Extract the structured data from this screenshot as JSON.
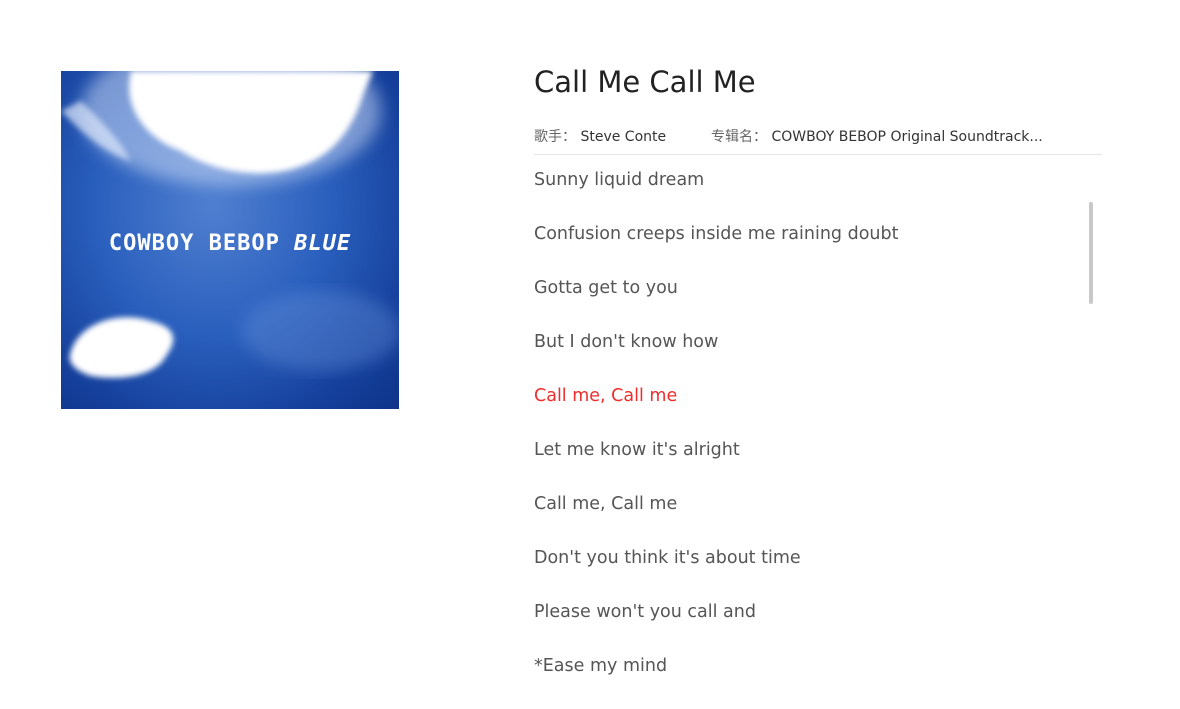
{
  "album_cover": {
    "title_main": "COWBOY BEBOP",
    "title_accent": "BLUE"
  },
  "song": {
    "title": "Call Me Call Me",
    "artist_label": "歌手：",
    "artist": "Steve Conte",
    "album_label": "专辑名：",
    "album": "COWBOY BEBOP Original Soundtrack..."
  },
  "lyrics": {
    "active_index": 4,
    "active_color": "#f02d2d",
    "lines": [
      "Sunny liquid dream",
      "Confusion creeps inside me raining doubt",
      "Gotta get to you",
      "But I don't know how",
      "Call me, Call me",
      "Let me know it's alright",
      "Call me, Call me",
      "Don't you think it's about time",
      "Please won't you call and",
      "*Ease my mind"
    ]
  }
}
